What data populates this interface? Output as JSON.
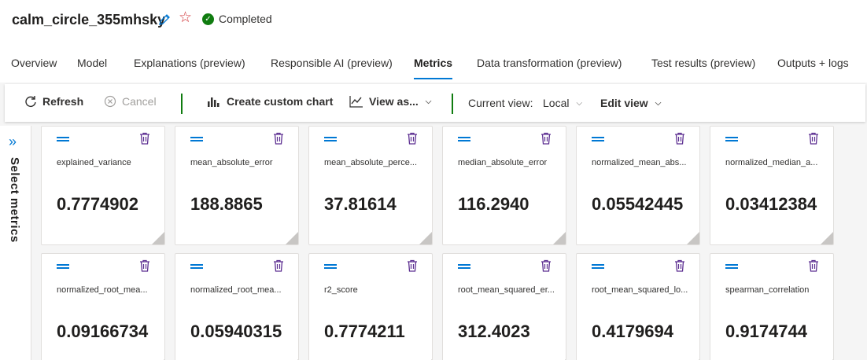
{
  "run": {
    "title": "calm_circle_355mhsky",
    "status": "Completed"
  },
  "tabs": [
    {
      "label": "Overview"
    },
    {
      "label": "Model"
    },
    {
      "label": "Explanations (preview)"
    },
    {
      "label": "Responsible AI (preview)"
    },
    {
      "label": "Metrics",
      "active": true
    },
    {
      "label": "Data transformation (preview)"
    },
    {
      "label": "Test results (preview)"
    },
    {
      "label": "Outputs + logs"
    }
  ],
  "toolbar": {
    "refresh_label": "Refresh",
    "cancel_label": "Cancel",
    "create_chart_label": "Create custom chart",
    "view_as_label": "View as...",
    "current_view_label": "Current view:",
    "current_view_value": "Local",
    "edit_view_label": "Edit view"
  },
  "sidebar": {
    "label": "Select metrics"
  },
  "metrics": [
    {
      "name": "explained_variance",
      "value": "0.7774902"
    },
    {
      "name": "mean_absolute_error",
      "value": "188.8865"
    },
    {
      "name": "mean_absolute_perce...",
      "value": "37.81614"
    },
    {
      "name": "median_absolute_error",
      "value": "116.2940"
    },
    {
      "name": "normalized_mean_abs...",
      "value": "0.05542445"
    },
    {
      "name": "normalized_median_a...",
      "value": "0.03412384"
    },
    {
      "name": "normalized_root_mea...",
      "value": "0.09166734"
    },
    {
      "name": "normalized_root_mea...",
      "value": "0.05940315"
    },
    {
      "name": "r2_score",
      "value": "0.7774211"
    },
    {
      "name": "root_mean_squared_er...",
      "value": "312.4023"
    },
    {
      "name": "root_mean_squared_lo...",
      "value": "0.4179694"
    },
    {
      "name": "spearman_correlation",
      "value": "0.9174744"
    }
  ],
  "colors": {
    "accent": "#0078d4",
    "success": "#107c10",
    "delete": "#5c2e91",
    "star": "#d13438"
  }
}
